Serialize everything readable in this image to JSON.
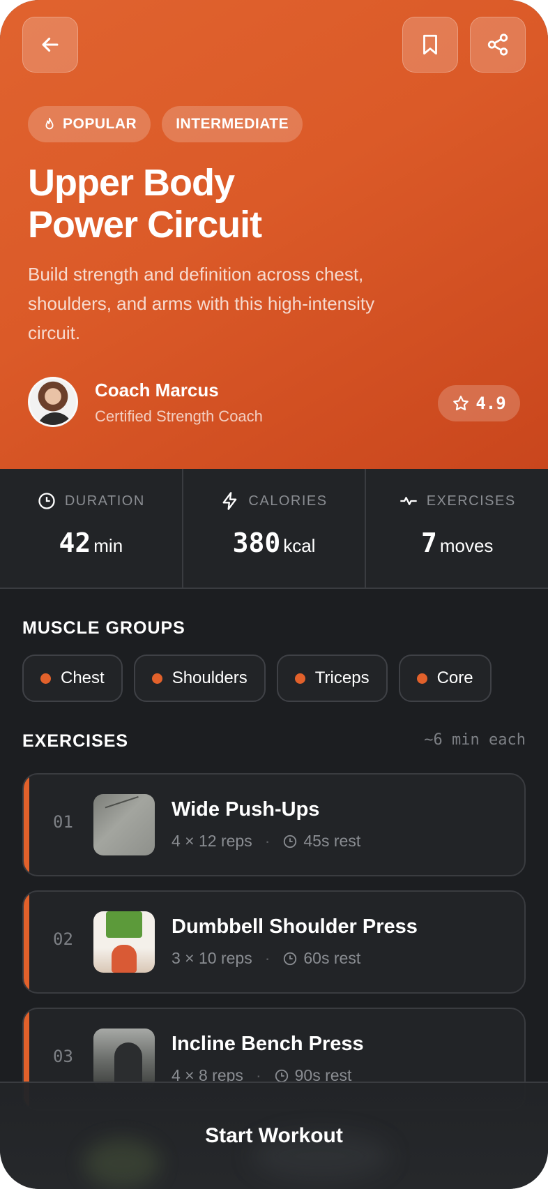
{
  "header": {
    "tags": [
      "POPULAR",
      "INTERMEDIATE"
    ],
    "title_line1": "Upper Body",
    "title_line2": "Power Circuit",
    "description": "Build strength and definition across chest, shoulders, and arms with this high-intensity circuit.",
    "coach": {
      "name": "Coach Marcus",
      "role": "Certified Strength Coach"
    },
    "rating": "4.9",
    "icons": {
      "back": "arrow-left-icon",
      "bookmark": "bookmark-icon",
      "share": "share-icon",
      "popular": "flame-icon",
      "rating": "star-icon"
    }
  },
  "stats": [
    {
      "label": "DURATION",
      "value": "42",
      "unit": "min",
      "icon": "clock-icon"
    },
    {
      "label": "CALORIES",
      "value": "380",
      "unit": "kcal",
      "icon": "lightning-icon"
    },
    {
      "label": "EXERCISES",
      "value": "7",
      "unit": "moves",
      "icon": "activity-icon"
    }
  ],
  "muscle_groups": {
    "title": "MUSCLE GROUPS",
    "items": [
      "Chest",
      "Shoulders",
      "Triceps",
      "Core"
    ]
  },
  "exercises": {
    "title": "EXERCISES",
    "meta": "~6 min each",
    "items": [
      {
        "num": "01",
        "name": "Wide Push-Ups",
        "reps": "4 × 12 reps",
        "rest": "45s rest"
      },
      {
        "num": "02",
        "name": "Dumbbell Shoulder Press",
        "reps": "3 × 10 reps",
        "rest": "60s rest"
      },
      {
        "num": "03",
        "name": "Incline Bench Press",
        "reps": "4 × 8 reps",
        "rest": "90s rest"
      }
    ]
  },
  "cta": {
    "label": "Start Workout"
  },
  "colors": {
    "accent": "#e2612b",
    "hero": "#db5a28",
    "background": "#1c1e21",
    "card": "#222427"
  }
}
